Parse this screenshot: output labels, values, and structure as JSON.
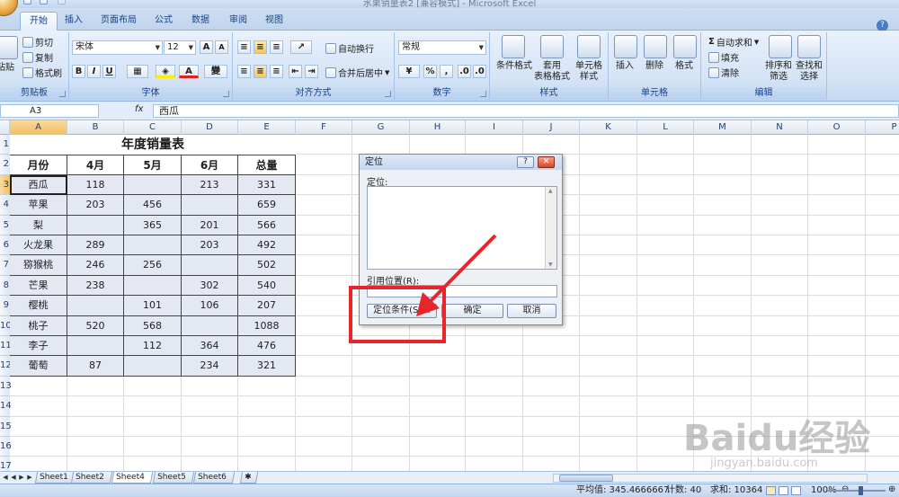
{
  "window": {
    "title": "水果销量表2 [兼容模式] - Microsoft Excel"
  },
  "tabs": [
    "开始",
    "插入",
    "页面布局",
    "公式",
    "数据",
    "审阅",
    "视图"
  ],
  "ribbon": {
    "clipboard": {
      "label": "剪贴板",
      "paste": "粘贴",
      "cut": "剪切",
      "copy": "复制",
      "format_painter": "格式刷"
    },
    "font": {
      "label": "字体",
      "name": "宋体",
      "size": "12",
      "bold": "B",
      "italic": "I",
      "underline": "U",
      "grow": "A",
      "shrink": "A",
      "phonetic": "變"
    },
    "alignment": {
      "label": "对齐方式",
      "wrap": "自动换行",
      "merge": "合并后居中"
    },
    "number": {
      "label": "数字",
      "format": "常规",
      "percent": "%",
      "comma": ","
    },
    "styles": {
      "label": "样式",
      "conditional": "条件格式",
      "table_format": "套用\n表格格式",
      "cell_styles": "单元格\n样式"
    },
    "cells": {
      "label": "单元格",
      "insert": "插入",
      "delete": "删除",
      "format": "格式"
    },
    "editing": {
      "label": "编辑",
      "autosum": "自动求和",
      "fill": "填充",
      "clear": "清除",
      "sort": "排序和\n筛选",
      "find": "查找和\n选择"
    }
  },
  "formula_bar": {
    "name_box": "A3",
    "fx": "fx",
    "value": "西瓜"
  },
  "columns": [
    "A",
    "B",
    "C",
    "D",
    "E",
    "F",
    "G",
    "H",
    "I",
    "J",
    "K",
    "L",
    "M",
    "N",
    "O",
    "P"
  ],
  "rows": [
    "1",
    "2",
    "3",
    "4",
    "5",
    "6",
    "7",
    "8",
    "9",
    "10",
    "11",
    "12",
    "13",
    "14",
    "15",
    "16",
    "17",
    "18"
  ],
  "table": {
    "title": "年度销量表",
    "headers": [
      "月份",
      "4月",
      "5月",
      "6月",
      "总量"
    ],
    "rows": [
      [
        "西瓜",
        "118",
        "",
        "213",
        "331"
      ],
      [
        "苹果",
        "203",
        "456",
        "",
        "659"
      ],
      [
        "梨",
        "",
        "365",
        "201",
        "566"
      ],
      [
        "火龙果",
        "289",
        "",
        "203",
        "492"
      ],
      [
        "猕猴桃",
        "246",
        "256",
        "",
        "502"
      ],
      [
        "芒果",
        "238",
        "",
        "302",
        "540"
      ],
      [
        "樱桃",
        "",
        "101",
        "106",
        "207"
      ],
      [
        "桃子",
        "520",
        "568",
        "",
        "1088"
      ],
      [
        "李子",
        "",
        "112",
        "364",
        "476"
      ],
      [
        "葡萄",
        "87",
        "",
        "234",
        "321"
      ]
    ]
  },
  "dialog": {
    "title": "定位",
    "help": "?",
    "close": "✕",
    "goto_label": "定位:",
    "reference_label": "引用位置(R):",
    "special_button": "定位条件(S)...",
    "ok_button": "确定",
    "cancel_button": "取消"
  },
  "sheets": [
    "Sheet1",
    "Sheet2",
    "Sheet4",
    "Sheet5",
    "Sheet6"
  ],
  "active_sheet": "Sheet4",
  "status": {
    "average": "平均值: 345.4666667",
    "count": "计数: 40",
    "sum": "求和: 10364",
    "zoom": "100%"
  },
  "watermark": {
    "main": "Baidu经验",
    "sub": "jingyan.baidu.com"
  },
  "colors": {
    "accent_red": "#e8252a",
    "ribbon_blue": "#15428b",
    "selected_header": "#f1c15f"
  }
}
